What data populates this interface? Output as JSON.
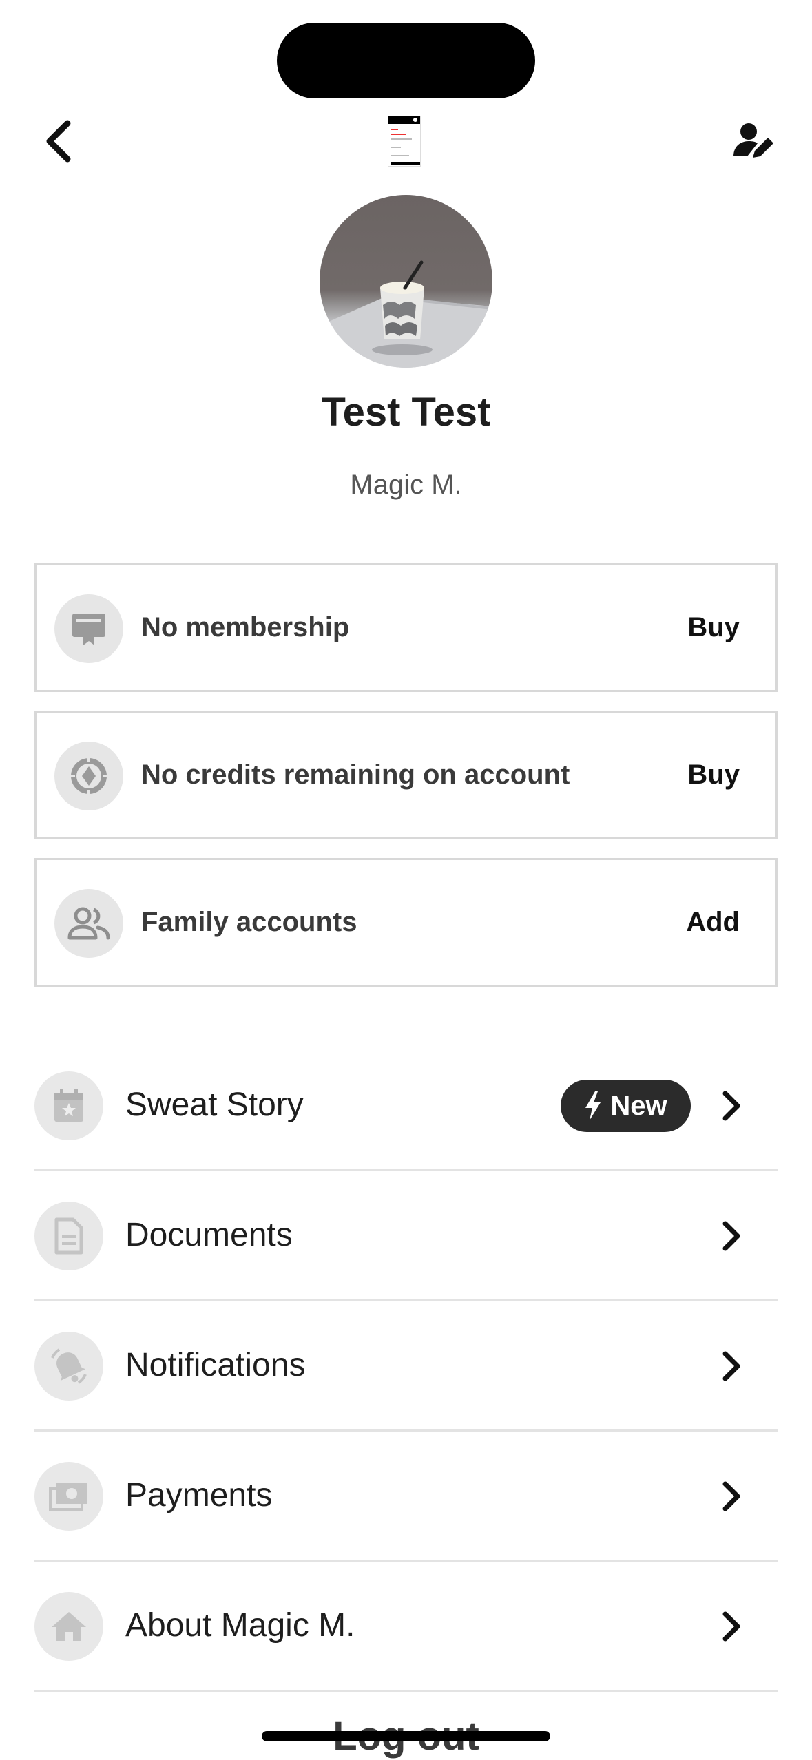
{
  "header": {
    "back_icon": "chevron-left-icon",
    "edit_icon": "edit-profile-icon"
  },
  "profile": {
    "name": "Test Test",
    "studio": "Magic M."
  },
  "cards": [
    {
      "icon": "membership-card-icon",
      "label": "No membership",
      "action": "Buy"
    },
    {
      "icon": "credits-coin-icon",
      "label": "No credits remaining on account",
      "action": "Buy"
    },
    {
      "icon": "family-icon",
      "label": "Family accounts",
      "action": "Add"
    }
  ],
  "menu": [
    {
      "icon": "calendar-star-icon",
      "label": "Sweat Story",
      "badge": "New"
    },
    {
      "icon": "document-icon",
      "label": "Documents"
    },
    {
      "icon": "bell-icon",
      "label": "Notifications"
    },
    {
      "icon": "money-icon",
      "label": "Payments"
    },
    {
      "icon": "home-icon",
      "label": "About Magic M."
    }
  ],
  "footer": {
    "logout_label": "Log out"
  },
  "colors": {
    "badge_bg": "#2b2b2b",
    "icon_circle": "#e6e6e6",
    "card_border": "#d8d8d8"
  }
}
